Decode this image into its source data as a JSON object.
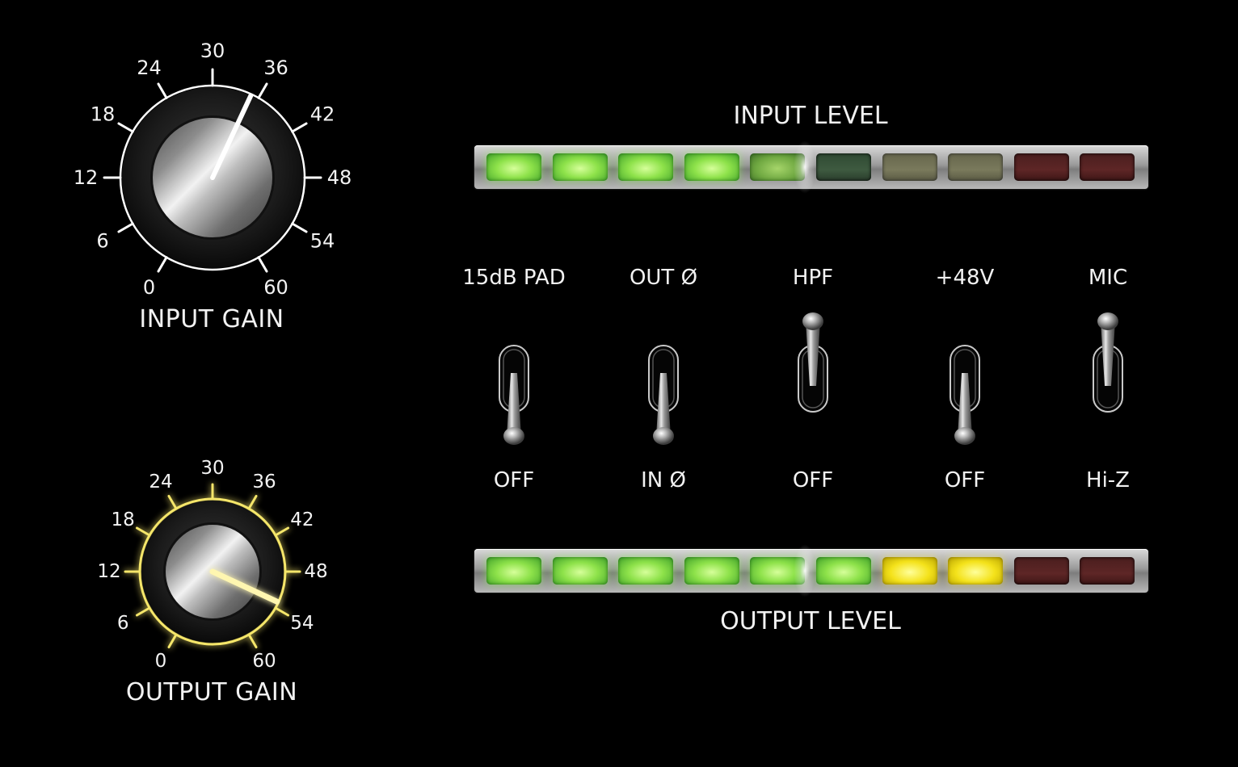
{
  "knobs": [
    {
      "id": "input",
      "title": "INPUT GAIN",
      "scale_labels": [
        "0",
        "6",
        "12",
        "18",
        "24",
        "30",
        "36",
        "42",
        "48",
        "54",
        "60"
      ],
      "value": 35,
      "glow": false,
      "accent_color": "#ffffff"
    },
    {
      "id": "output",
      "title": "OUTPUT GAIN",
      "scale_labels": [
        "0",
        "6",
        "12",
        "18",
        "24",
        "30",
        "36",
        "42",
        "48",
        "54",
        "60"
      ],
      "value": 53,
      "glow": true,
      "accent_color": "#f5e66a"
    }
  ],
  "meters": {
    "input": {
      "title": "INPUT LEVEL",
      "segments": [
        "green-on",
        "green-on",
        "green-on",
        "green-on",
        "green-dim",
        "green-off",
        "yellow-off",
        "yellow-off",
        "red-off",
        "red-off"
      ]
    },
    "output": {
      "title": "OUTPUT LEVEL",
      "segments": [
        "green-on",
        "green-on",
        "green-on",
        "green-on",
        "green-on",
        "green-on",
        "yellow-on",
        "yellow-on",
        "red-off",
        "red-off"
      ]
    }
  },
  "switches": [
    {
      "top_label": "15dB PAD",
      "bottom_label": "OFF",
      "position": "down"
    },
    {
      "top_label": "OUT Ø",
      "bottom_label": "IN Ø",
      "position": "down"
    },
    {
      "top_label": "HPF",
      "bottom_label": "OFF",
      "position": "up"
    },
    {
      "top_label": "+48V",
      "bottom_label": "OFF",
      "position": "down"
    },
    {
      "top_label": "MIC",
      "bottom_label": "Hi-Z",
      "position": "up"
    }
  ],
  "colors": {
    "background": "#000000",
    "text": "#f2f2f2",
    "glow": "#f5e66a"
  }
}
